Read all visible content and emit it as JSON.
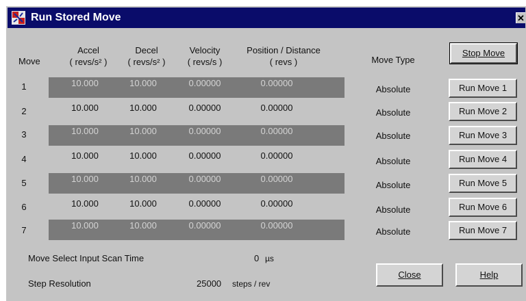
{
  "window": {
    "title": "Run Stored Move",
    "close_glyph": "✕"
  },
  "headers": {
    "move": "Move",
    "accel": "Accel",
    "accel_unit": "( revs/s² )",
    "decel": "Decel",
    "decel_unit": "( revs/s² )",
    "velocity": "Velocity",
    "velocity_unit": "( revs/s )",
    "position": "Position / Distance",
    "position_unit": "( revs )",
    "move_type": "Move Type"
  },
  "stop_button": "Stop Move",
  "rows": [
    {
      "num": "1",
      "accel": "10.000",
      "decel": "10.000",
      "velocity": "0.00000",
      "position": "0.00000",
      "type": "Absolute",
      "button": "Run Move 1"
    },
    {
      "num": "2",
      "accel": "10.000",
      "decel": "10.000",
      "velocity": "0.00000",
      "position": "0.00000",
      "type": "Absolute",
      "button": "Run Move 2"
    },
    {
      "num": "3",
      "accel": "10.000",
      "decel": "10.000",
      "velocity": "0.00000",
      "position": "0.00000",
      "type": "Absolute",
      "button": "Run Move 3"
    },
    {
      "num": "4",
      "accel": "10.000",
      "decel": "10.000",
      "velocity": "0.00000",
      "position": "0.00000",
      "type": "Absolute",
      "button": "Run Move 4"
    },
    {
      "num": "5",
      "accel": "10.000",
      "decel": "10.000",
      "velocity": "0.00000",
      "position": "0.00000",
      "type": "Absolute",
      "button": "Run Move 5"
    },
    {
      "num": "6",
      "accel": "10.000",
      "decel": "10.000",
      "velocity": "0.00000",
      "position": "0.00000",
      "type": "Absolute",
      "button": "Run Move 6"
    },
    {
      "num": "7",
      "accel": "10.000",
      "decel": "10.000",
      "velocity": "0.00000",
      "position": "0.00000",
      "type": "Absolute",
      "button": "Run Move 7"
    }
  ],
  "footer": {
    "scan_label": "Move Select Input Scan Time",
    "scan_value": "0",
    "scan_unit": "µs",
    "resolution_label": "Step Resolution",
    "resolution_value": "25000",
    "resolution_unit": "steps / rev",
    "close_button": "Close",
    "help_button": "Help"
  },
  "colors": {
    "titlebar": "#0a0c6a",
    "window_bg": "#c4c4c4",
    "row_band": "#7a7a7a"
  },
  "icons": {
    "title": "app-icon"
  }
}
